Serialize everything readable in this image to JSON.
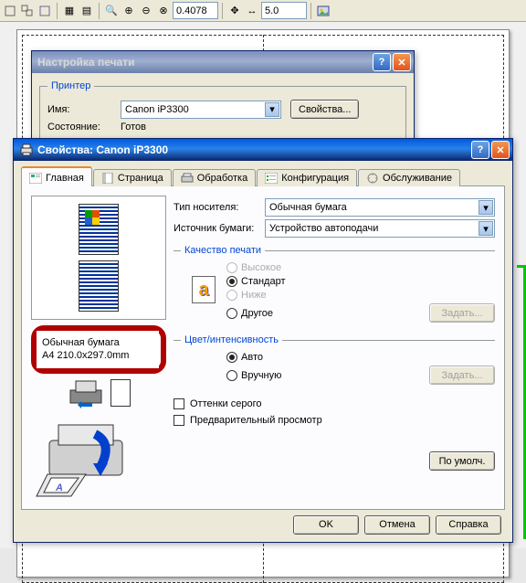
{
  "toolbar": {
    "zoom_value": "0.4078",
    "size_value": "5.0"
  },
  "print_setup": {
    "title": "Настройка печати",
    "group_printer": "Принтер",
    "name_label": "Имя:",
    "name_value": "Canon iP3300",
    "props_btn": "Свойства...",
    "status_label": "Состояние:",
    "status_value": "Готов"
  },
  "props": {
    "title": "Свойства: Canon iP3300",
    "tabs": {
      "main": "Главная",
      "page": "Страница",
      "proc": "Обработка",
      "conf": "Конфигурация",
      "serv": "Обслуживание"
    },
    "paper_type_label": "Тип носителя:",
    "paper_type_value": "Обычная бумага",
    "paper_src_label": "Источник бумаги:",
    "paper_src_value": "Устройство автоподачи",
    "quality_legend": "Качество печати",
    "quality": {
      "high": "Высокое",
      "std": "Стандарт",
      "low": "Ниже",
      "other": "Другое"
    },
    "color_legend": "Цвет/интенсивность",
    "color_auto": "Авто",
    "color_manual": "Вручную",
    "set_btn": "Задать...",
    "grayscale": "Оттенки серого",
    "preview": "Предварительный просмотр",
    "defaults_btn": "По умолч.",
    "paper_info_type": "Обычная бумага",
    "paper_info_size": "A4 210.0x297.0mm",
    "ok": "OK",
    "cancel": "Отмена",
    "help": "Справка"
  }
}
